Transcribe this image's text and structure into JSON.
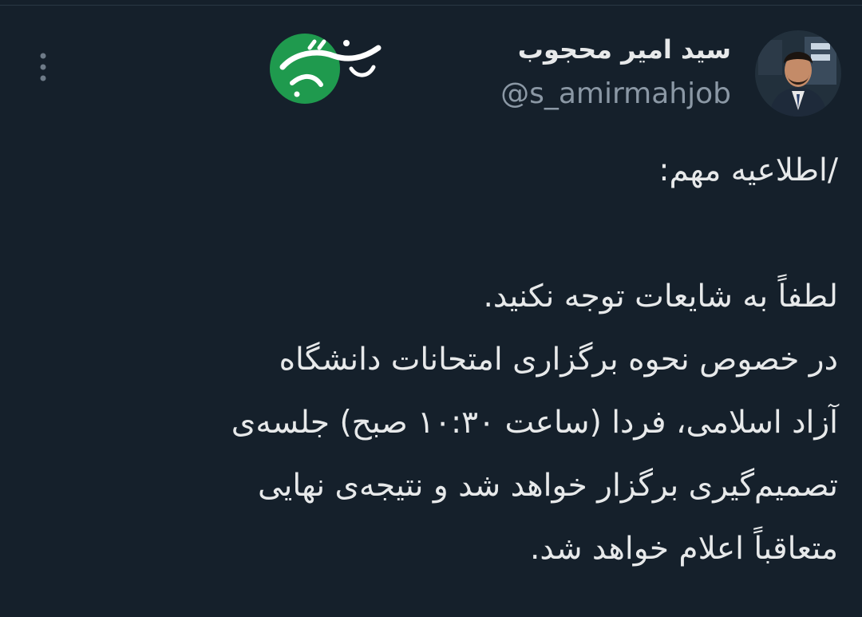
{
  "author": {
    "display_name": "سید امیر محجوب",
    "handle": "@s_amirmahjob"
  },
  "watermark": {
    "text": "خبرفوری",
    "color": "#1f9a4e"
  },
  "tweet": {
    "lines": [
      "/اطلاعیه مهم:",
      "",
      "لطفاً به شایعات توجه نکنید.",
      "در خصوص نحوه برگزاری امتحانات دانشگاه",
      "آزاد اسلامی، فردا (ساعت ۱۰:۳۰ صبح) جلسه‌ی",
      "تصمیم‌گیری برگزار خواهد شد و نتیجه‌ی نهایی",
      "متعاقباً اعلام خواهد شد."
    ]
  },
  "colors": {
    "background": "#15202b",
    "text": "#e7e9ea",
    "secondary": "#8b98a5"
  }
}
